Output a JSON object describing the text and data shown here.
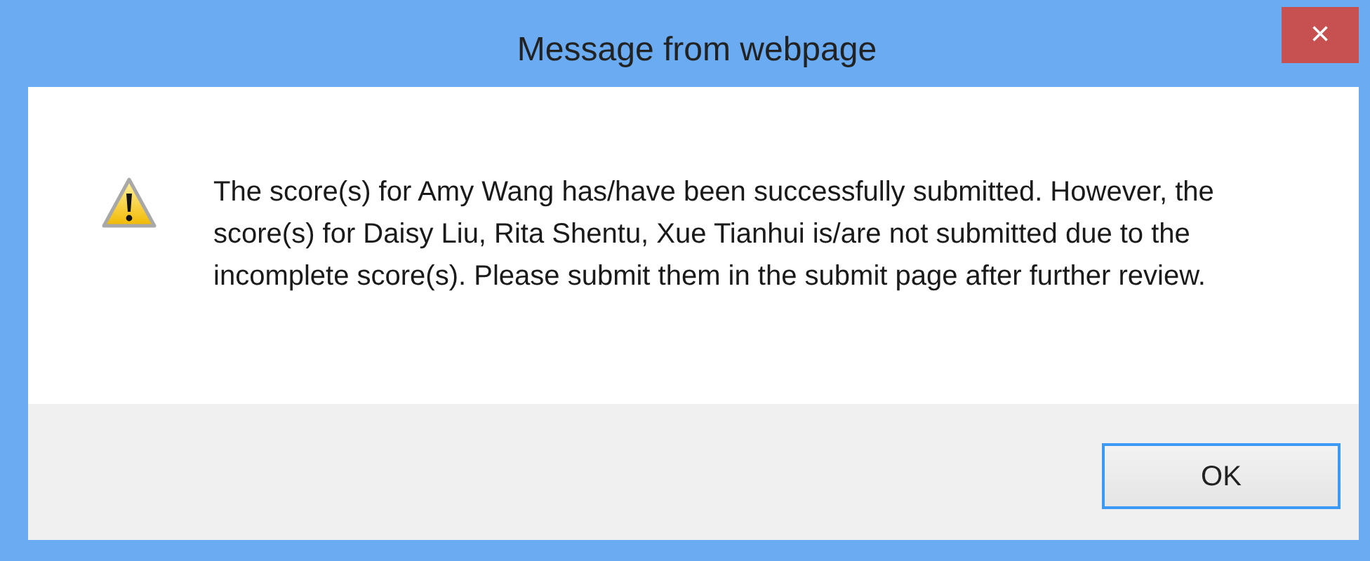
{
  "window": {
    "title": "Message from webpage",
    "close_label": "×"
  },
  "dialog": {
    "kind": "warning",
    "message": "The score(s) for Amy Wang has/have been successfully submitted. However, the score(s) for Daisy Liu, Rita Shentu, Xue Tianhui is/are not submitted due to the incomplete score(s). Please submit them in the submit page after further review."
  },
  "buttons": [
    {
      "label": "OK",
      "focused": true
    }
  ]
}
